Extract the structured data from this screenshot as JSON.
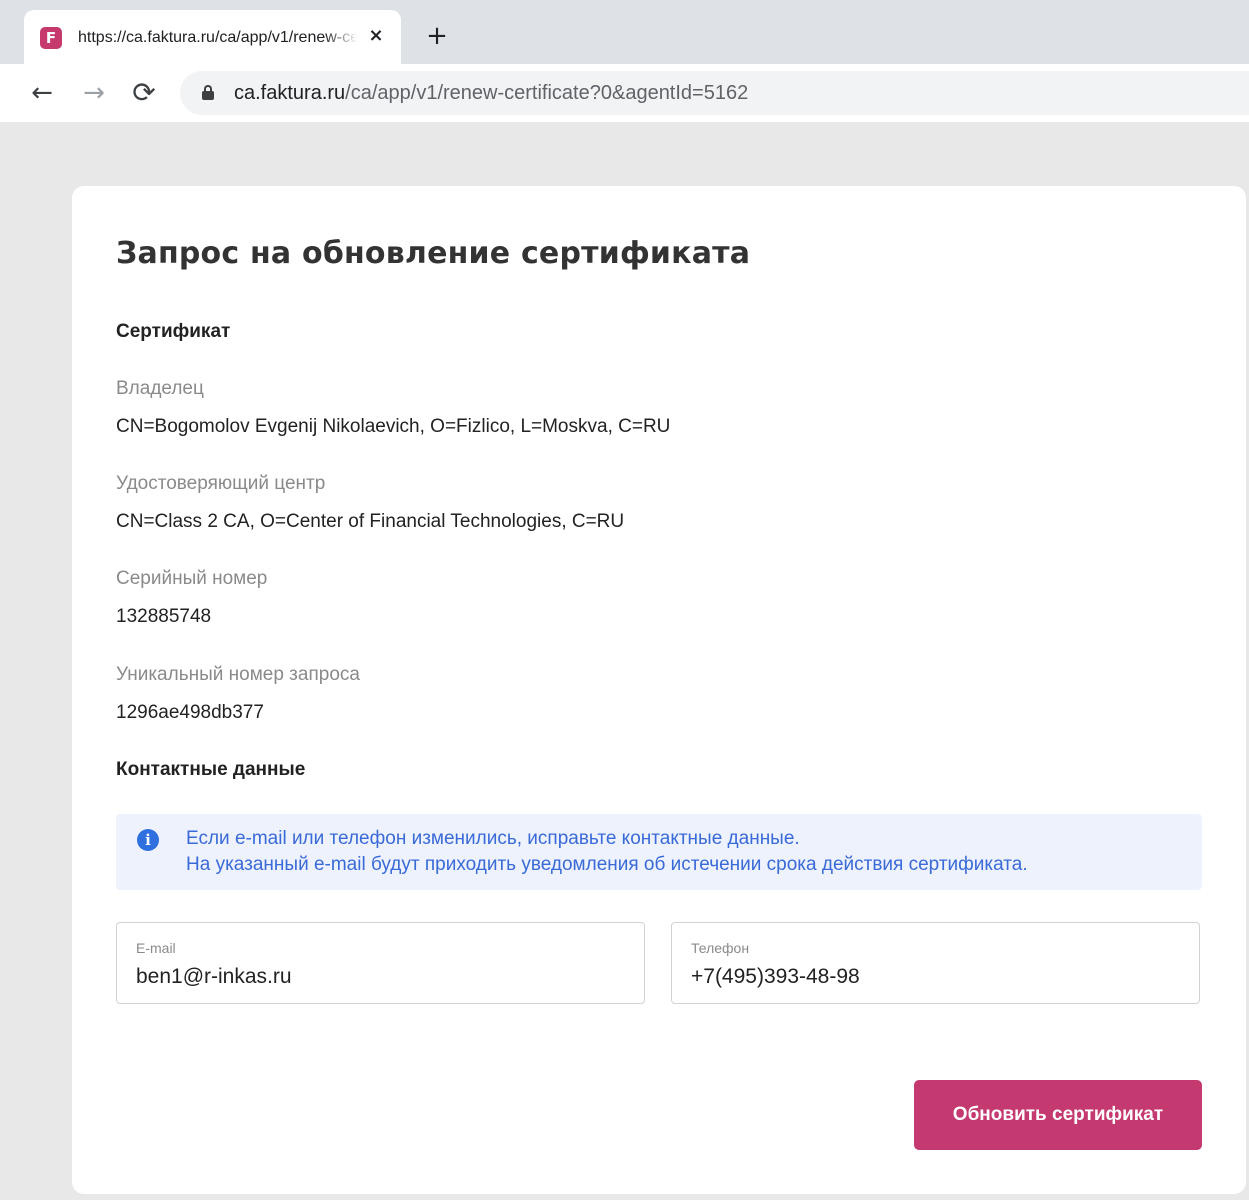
{
  "browser": {
    "tab_favicon": "F",
    "tab_title": "https://ca.faktura.ru/ca/app/v1/renew-certificate",
    "url_host": "ca.faktura.ru",
    "url_path": "/ca/app/v1/renew-certificate?0&agentId=5162",
    "icons": {
      "close": "×",
      "new_tab": "+",
      "back": "←",
      "forward": "→",
      "reload": "⟳",
      "info": "i"
    }
  },
  "page": {
    "title": "Запрос на обновление сертификата",
    "certificate_section": "Сертификат",
    "fields": [
      {
        "label": "Владелец",
        "value": "CN=Bogomolov Evgenij Nikolaevich, O=Fizlico, L=Moskva, C=RU"
      },
      {
        "label": "Удостоверяющий центр",
        "value": "CN=Class 2 CA, O=Center of Financial Technologies, C=RU"
      },
      {
        "label": "Серийный номер",
        "value": "132885748"
      },
      {
        "label": "Уникальный номер запроса",
        "value": "1296ae498db377"
      }
    ],
    "contacts_section": "Контактные данные",
    "info_lines": [
      "Если e-mail или телефон изменились, исправьте контактные данные.",
      "На указанный e-mail будут приходить уведомления об истечении срока действия сертификата."
    ],
    "email": {
      "label": "E-mail",
      "value": "ben1@r-inkas.ru"
    },
    "phone": {
      "label": "Телефон",
      "value": "+7(495)393-48-98"
    },
    "submit_label": "Обновить сертификат"
  },
  "colors": {
    "accent": "#c4396f",
    "info_bg": "#edf2fc",
    "info_text": "#3a6ad8"
  }
}
